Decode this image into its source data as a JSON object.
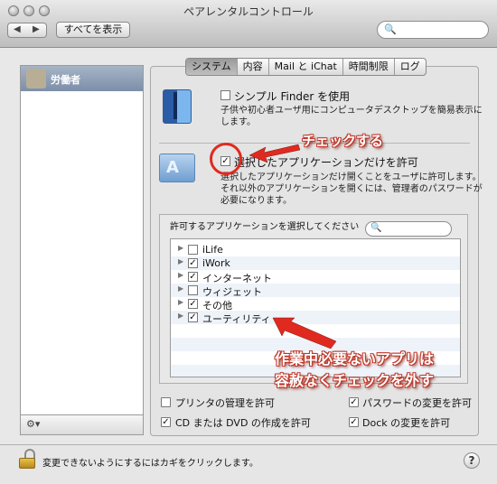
{
  "window": {
    "title": "ペアレンタルコントロール"
  },
  "toolbar": {
    "back": "◀",
    "forward": "▶",
    "show_all": "すべてを表示",
    "search_placeholder": ""
  },
  "sidebar": {
    "user_label": "労働者",
    "gear": "⚙▾"
  },
  "tabs": [
    {
      "label": "システム",
      "selected": true
    },
    {
      "label": "内容",
      "selected": false
    },
    {
      "label": "Mail と iChat",
      "selected": false
    },
    {
      "label": "時間制限",
      "selected": false
    },
    {
      "label": "ログ",
      "selected": false
    }
  ],
  "simple_finder": {
    "label": "シンプル Finder を使用",
    "checked": false,
    "desc1": "子供や初心者ユーザ用にコンピュータデスクトップを簡易表示に",
    "desc2": "します。"
  },
  "restrict_apps": {
    "label": "選択したアプリケーションだけを許可",
    "checked": true,
    "desc1": "選択したアプリケーションだけ開くことをユーザに許可します。",
    "desc2": "それ以外のアプリケーションを開くには、管理者のパスワードが",
    "desc3": "必要になります。"
  },
  "app_list": {
    "heading": "許可するアプリケーションを選択してください",
    "search_placeholder": "",
    "items": [
      {
        "label": "iLife",
        "checked": false
      },
      {
        "label": "iWork",
        "checked": true
      },
      {
        "label": "インターネット",
        "checked": true
      },
      {
        "label": "ウィジェット",
        "checked": false
      },
      {
        "label": "その他",
        "checked": true
      },
      {
        "label": "ユーティリティ",
        "checked": true
      }
    ]
  },
  "options": {
    "printer": {
      "label": "プリンタの管理を許可",
      "checked": false
    },
    "password": {
      "label": "パスワードの変更を許可",
      "checked": true
    },
    "cd_dvd": {
      "label": "CD または DVD の作成を許可",
      "checked": true
    },
    "dock": {
      "label": "Dock の変更を許可",
      "checked": true
    }
  },
  "footer": {
    "lock_text": "変更できないようにするにはカギをクリックします。",
    "help": "?"
  },
  "annotations": {
    "check_label": "チェックする",
    "note_line1": "作業中必要ないアプリは",
    "note_line2": "容赦なくチェックを外す",
    "color": "#e02a1f"
  }
}
